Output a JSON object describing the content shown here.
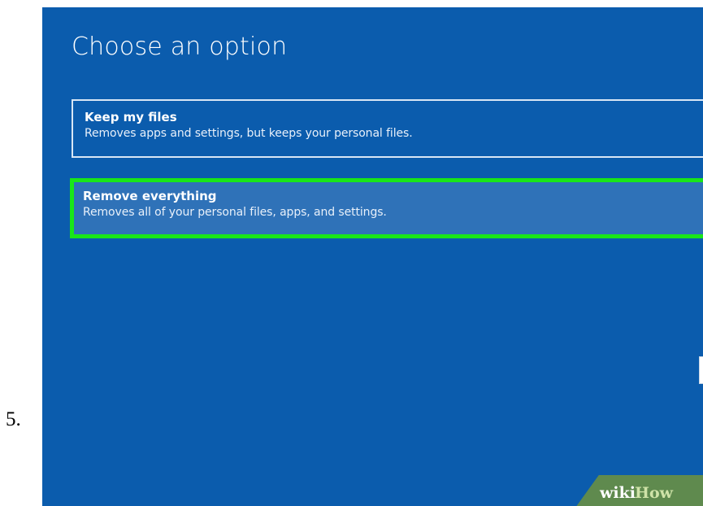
{
  "step_number": "5.",
  "screen": {
    "title": "Choose an option",
    "background_color": "#0b5cad",
    "options": [
      {
        "title": "Keep my files",
        "description": "Removes apps and settings, but keeps your personal files.",
        "highlighted": false
      },
      {
        "title": "Remove everything",
        "description": "Removes all of your personal files, apps, and settings.",
        "highlighted": true,
        "highlight_color": "#19e619"
      }
    ]
  },
  "watermark": {
    "text_wiki": "wiki",
    "text_how": "How"
  }
}
